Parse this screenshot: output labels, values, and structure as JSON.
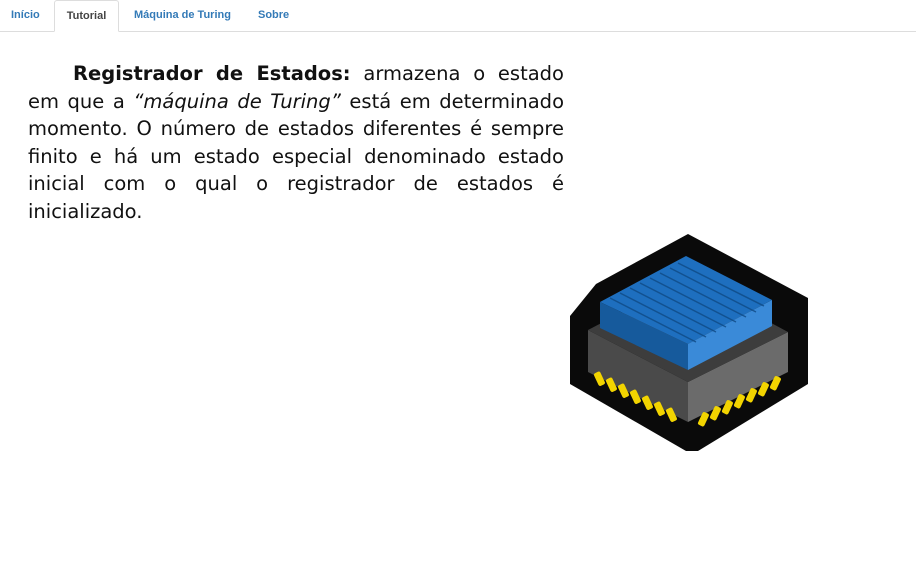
{
  "nav": {
    "tabs": [
      {
        "label": "Início"
      },
      {
        "label": "Tutorial"
      },
      {
        "label": "Máquina de Turing"
      },
      {
        "label": "Sobre"
      }
    ],
    "active_tab": "Tutorial"
  },
  "content": {
    "term": "Registrador de Estados:",
    "text_before_quote": " armazena o estado em que a ",
    "quoted": "“máquina de Turing”",
    "text_after_quote": " está em determinado momento. O número de estados diferentes é sempre finito e há um estado especial denominado estado inicial com o qual o registrador de estados é inicializado."
  },
  "illustration": {
    "icon": "processor-chip-icon",
    "colors": {
      "outline": "#0a0a0a",
      "body": "#4a4a4a",
      "body_light": "#6b6b6b",
      "heatsink": "#1e6fbf",
      "heatsink_light": "#3a8ad8",
      "pins": "#f2d400"
    }
  }
}
